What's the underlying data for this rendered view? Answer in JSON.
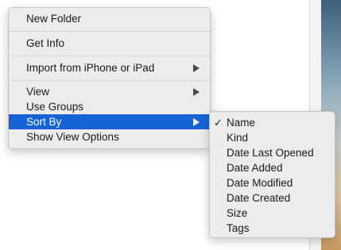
{
  "context_menu": {
    "items": [
      {
        "label": "New Folder"
      },
      {
        "label": "Get Info"
      },
      {
        "label": "Import from iPhone or iPad"
      },
      {
        "label": "View"
      },
      {
        "label": "Use Groups"
      },
      {
        "label": "Sort By"
      },
      {
        "label": "Show View Options"
      }
    ]
  },
  "sort_submenu": {
    "checkmark": "✓",
    "checked_item": "Name",
    "items": [
      {
        "label": "Name"
      },
      {
        "label": "Kind"
      },
      {
        "label": "Date Last Opened"
      },
      {
        "label": "Date Added"
      },
      {
        "label": "Date Modified"
      },
      {
        "label": "Date Created"
      },
      {
        "label": "Size"
      },
      {
        "label": "Tags"
      }
    ]
  },
  "colors": {
    "highlight": "#1763d6",
    "menu_background": "#ececec"
  },
  "icons": [
    "submenu-arrow-icon",
    "checkmark-icon"
  ]
}
